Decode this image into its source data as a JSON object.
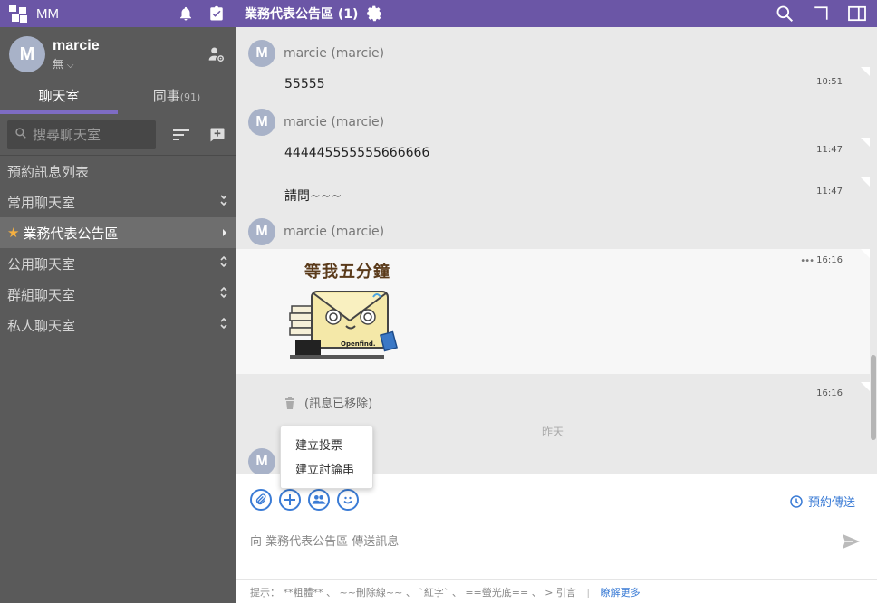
{
  "app": {
    "name": "MM"
  },
  "profile": {
    "initial": "M",
    "name": "marcie",
    "status": "無"
  },
  "tabs": [
    {
      "label": "聊天室",
      "count": ""
    },
    {
      "label": "同事",
      "count": "(91)"
    }
  ],
  "search": {
    "placeholder": "搜尋聊天室"
  },
  "sidebar": {
    "items": [
      {
        "label": "預約訊息列表"
      },
      {
        "label": "常用聊天室"
      },
      {
        "label": "業務代表公告區"
      },
      {
        "label": "公用聊天室"
      },
      {
        "label": "群組聊天室"
      },
      {
        "label": "私人聊天室"
      }
    ]
  },
  "header": {
    "title": "業務代表公告區 (1)"
  },
  "messages": {
    "sender": "marcie (marcie)",
    "avatar_initial": "M",
    "m1_text": "55555",
    "m1_time": "10:51",
    "m2_text": "444445555555666666",
    "m2_time": "11:47",
    "m3_text": "請問~~~",
    "m3_time": "11:47",
    "sticker_time": "16:16",
    "sticker_dots": "•••",
    "sticker_caption": "等我五分鐘",
    "sticker_brand": "Openfind.",
    "deleted_text": "(訊息已移除)",
    "deleted_time": "16:16",
    "date_divider": "昨天"
  },
  "popup": {
    "items": [
      "建立投票",
      "建立討論串"
    ]
  },
  "composer": {
    "schedule_label": "預約傳送",
    "placeholder": "向 業務代表公告區 傳送訊息",
    "hint": "提示： **粗體** 、 ~~刪除線~~ 、 `紅字` 、 ==螢光底== 、 > 引言",
    "hint_sep": "|",
    "hint_more": "瞭解更多"
  },
  "colors": {
    "brand": "#6b56a6",
    "accent": "#3a7bd5",
    "sidebar": "#5a5a5a"
  },
  "icons": [
    "bell-icon",
    "task-icon",
    "settings-icon",
    "search-icon",
    "expand-icon",
    "layout-icon",
    "attach-icon",
    "add-icon",
    "group-icon",
    "emoji-icon",
    "clock-icon",
    "send-icon",
    "trash-icon"
  ]
}
